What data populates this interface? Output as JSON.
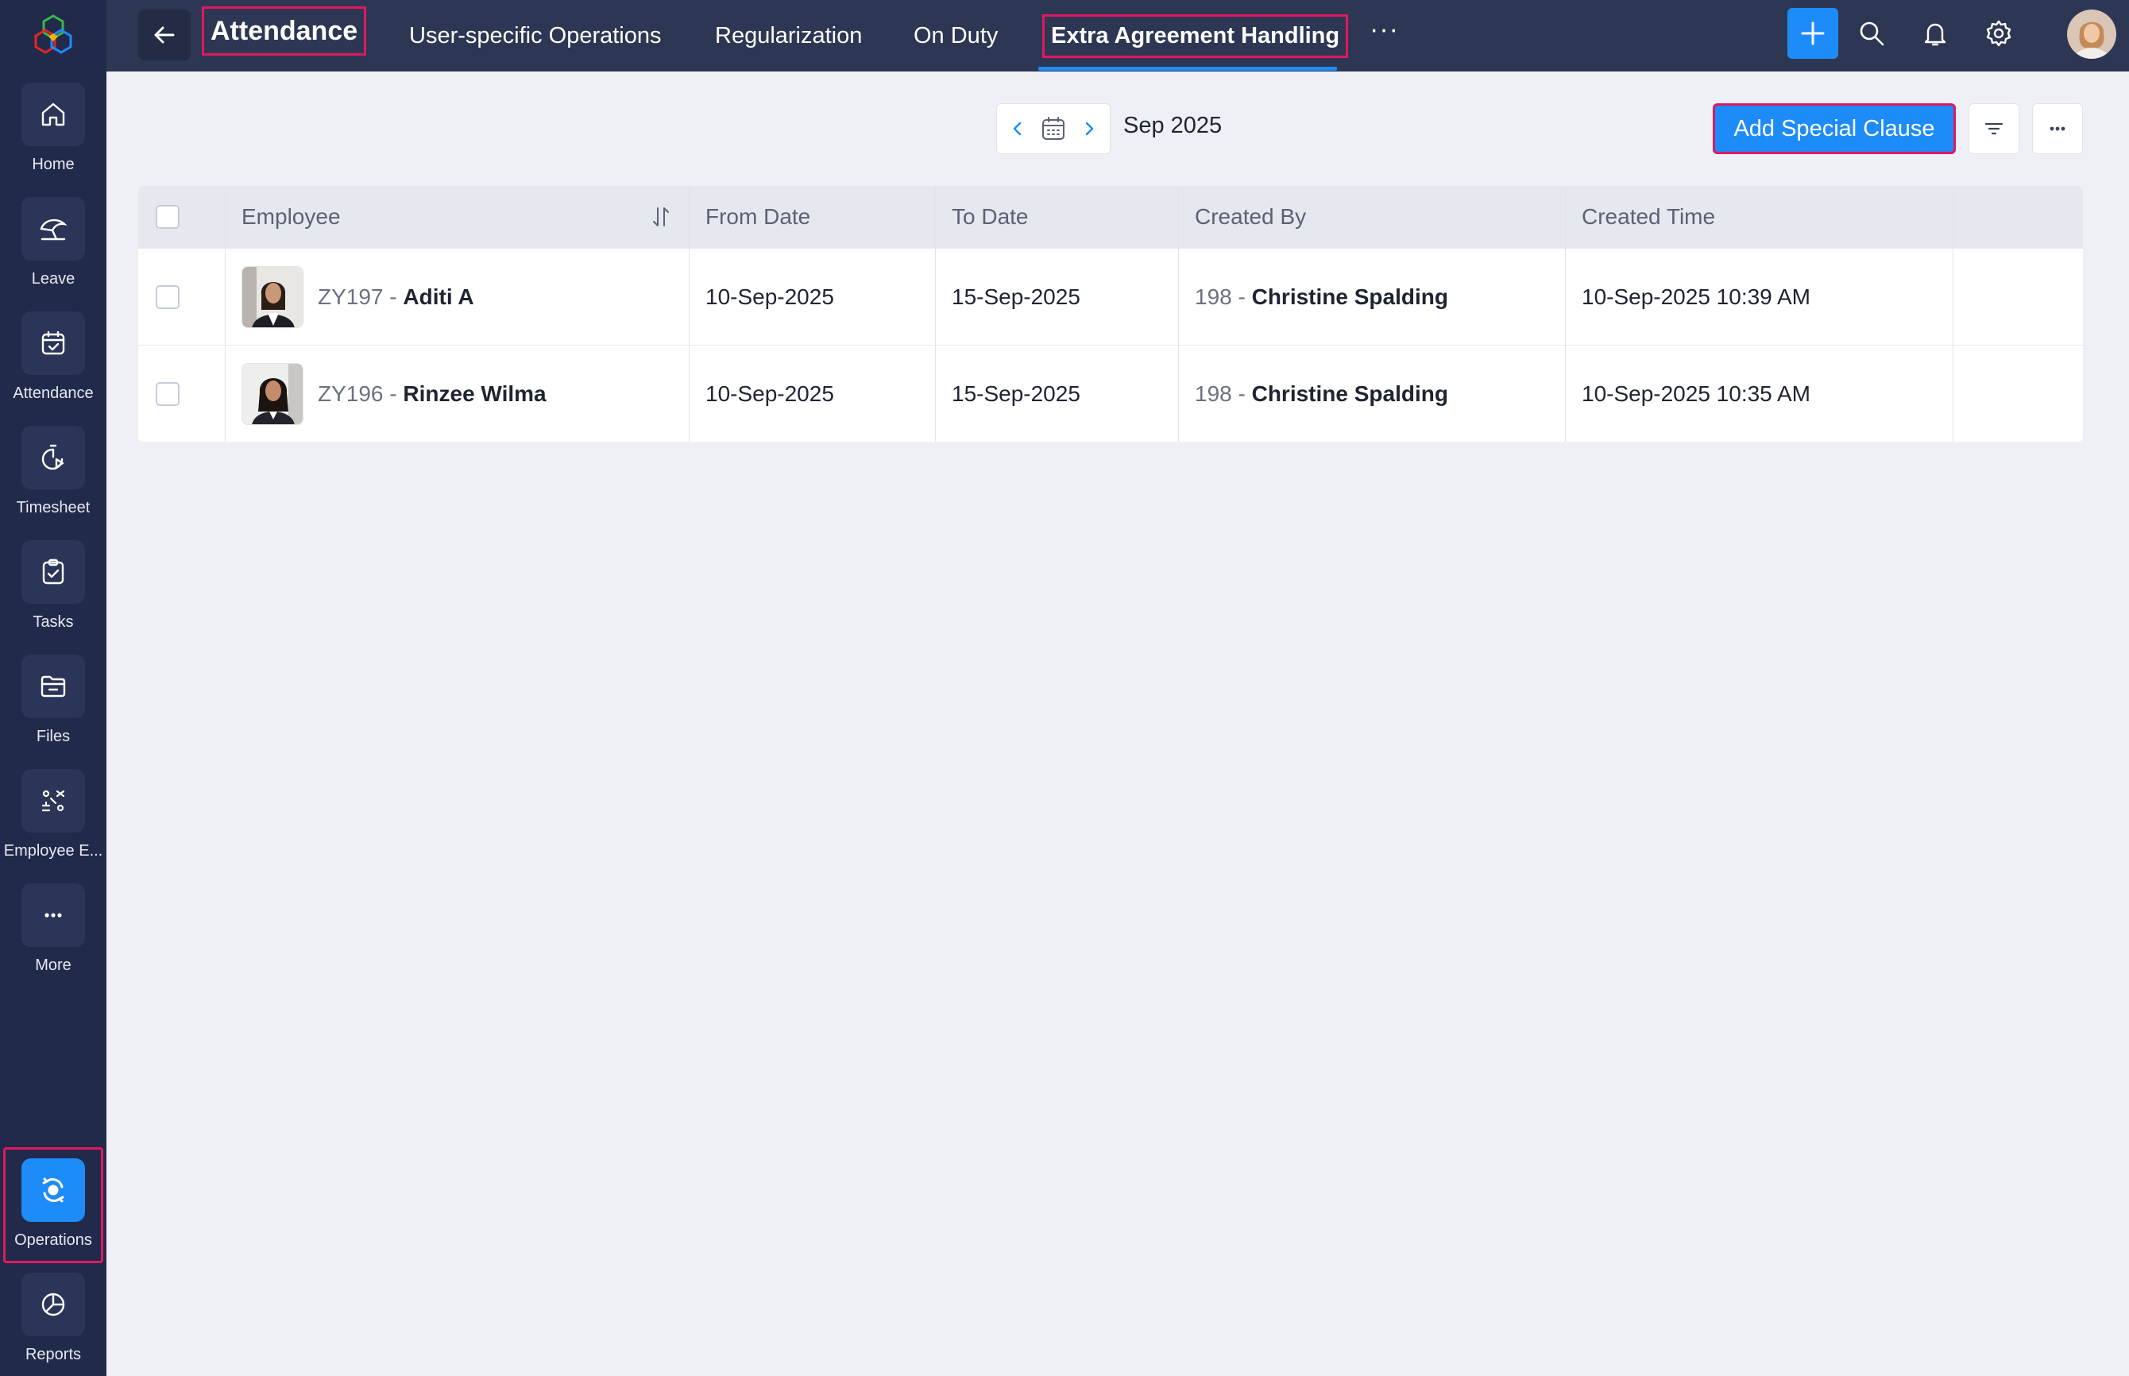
{
  "sidebar": {
    "items": [
      {
        "label": "Home",
        "icon": "home-icon"
      },
      {
        "label": "Leave",
        "icon": "umbrella-icon"
      },
      {
        "label": "Attendance",
        "icon": "calendar-check-icon"
      },
      {
        "label": "Timesheet",
        "icon": "timer-icon"
      },
      {
        "label": "Tasks",
        "icon": "clipboard-check-icon"
      },
      {
        "label": "Files",
        "icon": "folder-icon"
      },
      {
        "label": "Employee E...",
        "icon": "employee-engagement-icon"
      },
      {
        "label": "More",
        "icon": "more-dots-icon"
      },
      {
        "label": "Operations",
        "icon": "operations-icon",
        "active": true
      },
      {
        "label": "Reports",
        "icon": "pie-chart-icon"
      }
    ]
  },
  "header": {
    "module_title": "Attendance",
    "tabs": [
      {
        "label": "User-specific Operations"
      },
      {
        "label": "Regularization"
      },
      {
        "label": "On Duty"
      },
      {
        "label": "Extra Agreement Handling",
        "active": true
      }
    ],
    "more_label": "···"
  },
  "toolbar": {
    "month": "Sep 2025",
    "add_button_label": "Add Special Clause",
    "more_label": "···"
  },
  "table": {
    "columns": [
      "Employee",
      "From Date",
      "To Date",
      "Created By",
      "Created Time"
    ],
    "rows": [
      {
        "emp_id": "ZY197 - ",
        "emp_name": "Aditi A",
        "from_date": "10-Sep-2025",
        "to_date": "15-Sep-2025",
        "creator_id": "198 - ",
        "creator_name": "Christine Spalding",
        "created_time": "10-Sep-2025 10:39 AM"
      },
      {
        "emp_id": "ZY196 - ",
        "emp_name": "Rinzee Wilma",
        "from_date": "10-Sep-2025",
        "to_date": "15-Sep-2025",
        "creator_id": "198 - ",
        "creator_name": "Christine Spalding",
        "created_time": "10-Sep-2025 10:35 AM"
      }
    ]
  },
  "colors": {
    "sidebar_bg": "#212a4a",
    "topbar_bg": "#2d3653",
    "accent": "#1d8cf8",
    "highlight": "#e0185f"
  }
}
